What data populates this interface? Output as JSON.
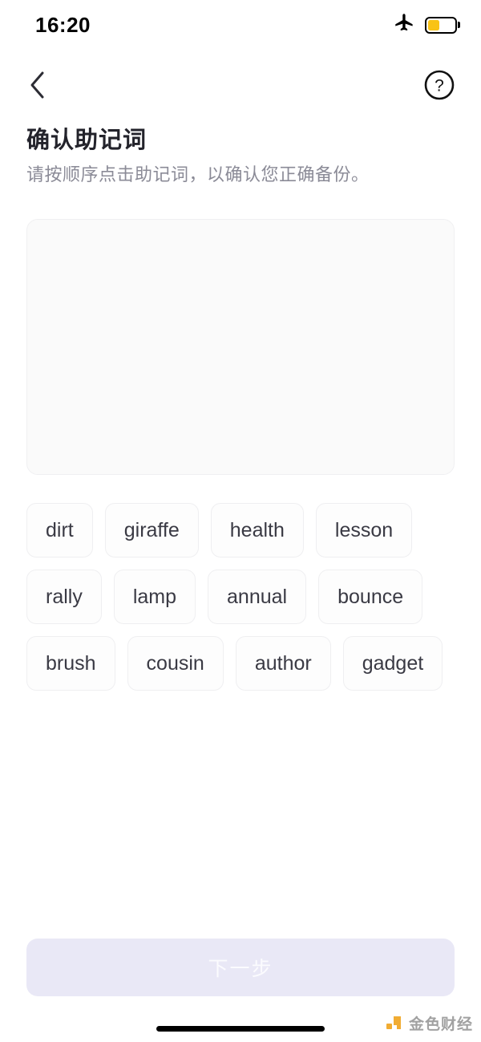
{
  "status_bar": {
    "time": "16:20",
    "airplane_icon": "airplane-icon",
    "battery_icon": "battery-icon",
    "battery_level_percent": 45,
    "battery_color": "#f9c315"
  },
  "nav": {
    "back_icon": "chevron-left-icon",
    "help_icon": "question-mark-circle-icon"
  },
  "heading": {
    "title": "确认助记词",
    "subtitle": "请按顺序点击助记词，以确认您正确备份。"
  },
  "answer_box": {
    "selected_words": [],
    "background_color": "#fafafa",
    "border_color": "#f0f0f2"
  },
  "word_pool": {
    "words": [
      "dirt",
      "giraffe",
      "health",
      "lesson",
      "rally",
      "lamp",
      "annual",
      "bounce",
      "brush",
      "cousin",
      "author",
      "gadget"
    ],
    "chip_text_color": "#3a3a44"
  },
  "footer": {
    "next_label": "下一步",
    "next_enabled": false,
    "next_background_color": "#e9e8f6",
    "next_text_color": "#fbfbfe"
  },
  "watermark": {
    "text": "金色财经",
    "logo_color": "#f0a522"
  }
}
